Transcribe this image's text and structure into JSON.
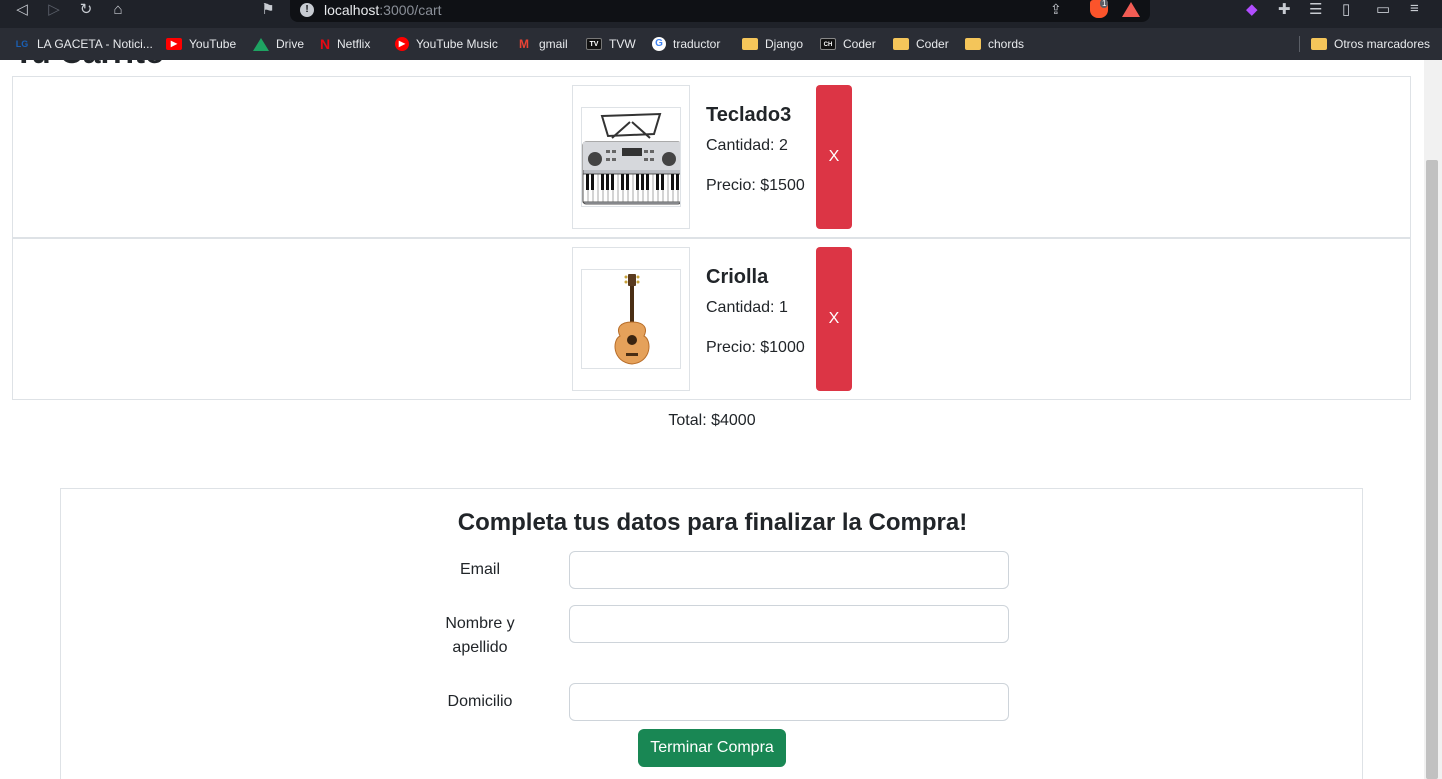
{
  "browser": {
    "url_host": "localhost",
    "url_path": ":3000/cart",
    "bookmarks": [
      {
        "label": "LA GACETA - Notici...",
        "icon": "lg-icon",
        "color": "#1a5fb4"
      },
      {
        "label": "YouTube",
        "icon": "youtube-icon",
        "color": "#ff0000"
      },
      {
        "label": "Drive",
        "icon": "drive-icon",
        "color": "#1ea362"
      },
      {
        "label": "Netflix",
        "icon": "netflix-icon",
        "color": "#e50914"
      },
      {
        "label": "YouTube Music",
        "icon": "youtube-music-icon",
        "color": "#ff0000"
      },
      {
        "label": "gmail",
        "icon": "gmail-icon",
        "color": "#ea4335"
      },
      {
        "label": "TVW",
        "icon": "tv-icon",
        "color": "#111111"
      },
      {
        "label": "traductor",
        "icon": "google-icon",
        "color": "#ffffff"
      },
      {
        "label": "Django",
        "icon": "folder-icon",
        "color": "#f4c55a"
      },
      {
        "label": "Coder",
        "icon": "coder-icon",
        "color": "#111111"
      },
      {
        "label": "Coder",
        "icon": "folder-icon",
        "color": "#f4c55a"
      },
      {
        "label": "chords",
        "icon": "folder-icon",
        "color": "#f4c55a"
      }
    ],
    "other_bookmarks": "Otros marcadores",
    "brave_count": "1"
  },
  "page": {
    "heading": "Tu Carrito"
  },
  "cart": {
    "items": [
      {
        "name": "Teclado3",
        "quantity": "Cantidad: 2",
        "price": "Precio: $1500",
        "image": "keyboard-image",
        "remove_label": "X"
      },
      {
        "name": "Criolla",
        "quantity": "Cantidad: 1",
        "price": "Precio: $1000",
        "image": "guitar-image",
        "remove_label": "X"
      }
    ],
    "total": "Total: $4000"
  },
  "checkout": {
    "title": "Completa tus datos para finalizar la Compra!",
    "fields": [
      {
        "label": "Email",
        "value": "",
        "placeholder": ""
      },
      {
        "label": "Nombre y apellido",
        "value": "",
        "placeholder": ""
      },
      {
        "label": "Domicilio",
        "value": "",
        "placeholder": ""
      }
    ],
    "submit_label": "Terminar Compra"
  },
  "colors": {
    "danger": "#dc3545",
    "success": "#198754",
    "border": "#dee2e6"
  }
}
